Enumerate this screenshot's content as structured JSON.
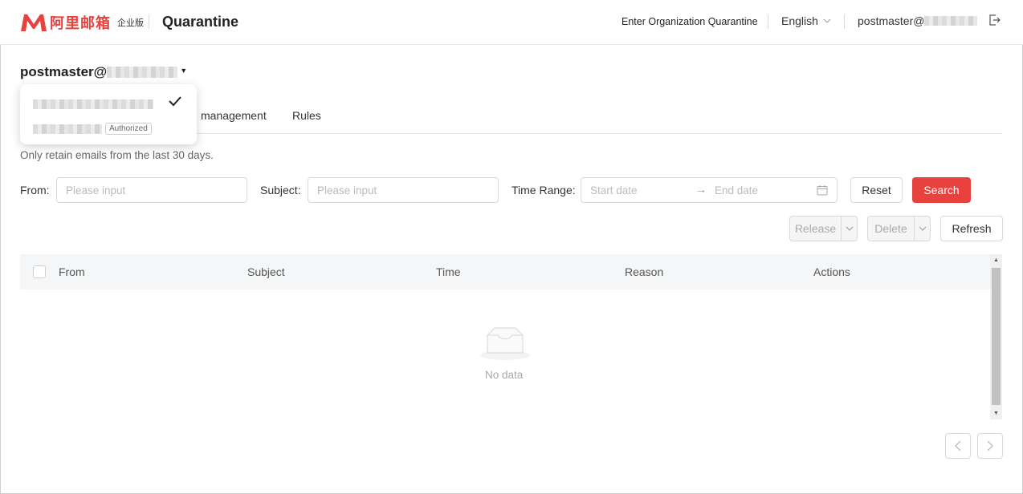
{
  "header": {
    "logo_cn": "阿里邮箱",
    "logo_edition": "企业版",
    "app_title": "Quarantine",
    "org_link": "Enter Organization Quarantine",
    "language": "English",
    "account": "postmaster@"
  },
  "account_title": "postmaster@",
  "tabs": [
    {
      "label": "management"
    },
    {
      "label": "Rules"
    }
  ],
  "popover": {
    "badge": "Authorized"
  },
  "notice": "Only retain emails from the last 30 days.",
  "filters": {
    "from_label": "From:",
    "from_placeholder": "Please input",
    "subject_label": "Subject:",
    "subject_placeholder": "Please input",
    "time_label": "Time Range:",
    "start_placeholder": "Start date",
    "end_placeholder": "End date",
    "reset": "Reset",
    "search": "Search"
  },
  "actions": {
    "release": "Release",
    "delete": "Delete",
    "refresh": "Refresh"
  },
  "table": {
    "columns": [
      "From",
      "Subject",
      "Time",
      "Reason",
      "Actions"
    ],
    "empty_text": "No data"
  },
  "colors": {
    "accent": "#e8423e"
  }
}
